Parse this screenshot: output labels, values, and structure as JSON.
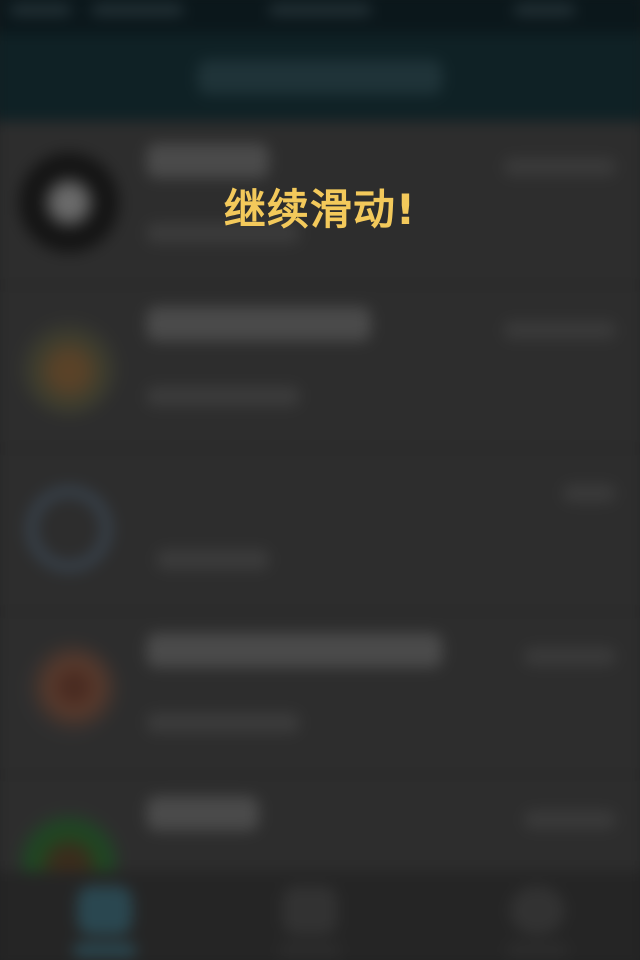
{
  "overlay": {
    "message": "继续滑动!"
  },
  "colors": {
    "toast_text": "#f3c95b",
    "header_bg": "#0f2125",
    "list_bg": "#2d2d2d"
  },
  "chat_list": {
    "rows": [
      {
        "avatar_icon": "avatar-circle-dark"
      },
      {
        "avatar_icon": "avatar-person"
      },
      {
        "avatar_icon": "avatar-headphones"
      },
      {
        "avatar_icon": "avatar-person"
      },
      {
        "avatar_icon": "avatar-group"
      }
    ]
  },
  "bottom_nav": {
    "tabs": [
      {
        "icon": "chat-icon"
      },
      {
        "icon": "person-icon"
      },
      {
        "icon": "circle-icon"
      }
    ]
  }
}
